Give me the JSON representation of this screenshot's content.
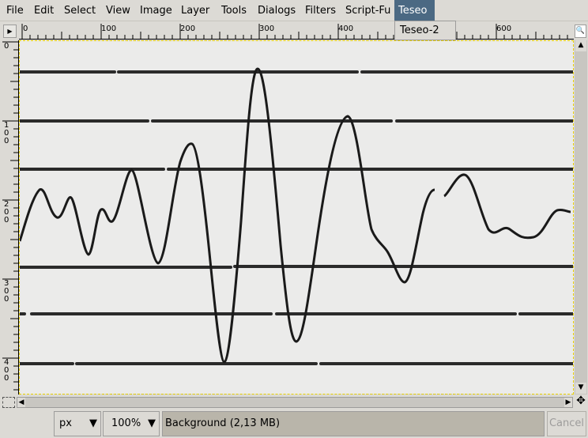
{
  "menu": [
    "File",
    "Edit",
    "Select",
    "View",
    "Image",
    "Layer",
    "Tools",
    "Dialogs",
    "Filters",
    "Script-Fu",
    "Teseo"
  ],
  "active_menu": "Teseo",
  "dropdown": {
    "items": [
      "Teseo-2"
    ]
  },
  "hruler": [
    "0",
    "100",
    "200",
    "300",
    "400",
    "600"
  ],
  "vruler": [
    "0",
    "1\n0\n0",
    "2\n0\n0",
    "3\n0\n0",
    "4\n0\n0"
  ],
  "status": {
    "unit": "px",
    "zoom": "100%",
    "message": "Background (2,13 MB)",
    "cancel": "Cancel"
  },
  "colors": {
    "menu_active": "#4b6983",
    "selection": "#e8d000"
  }
}
